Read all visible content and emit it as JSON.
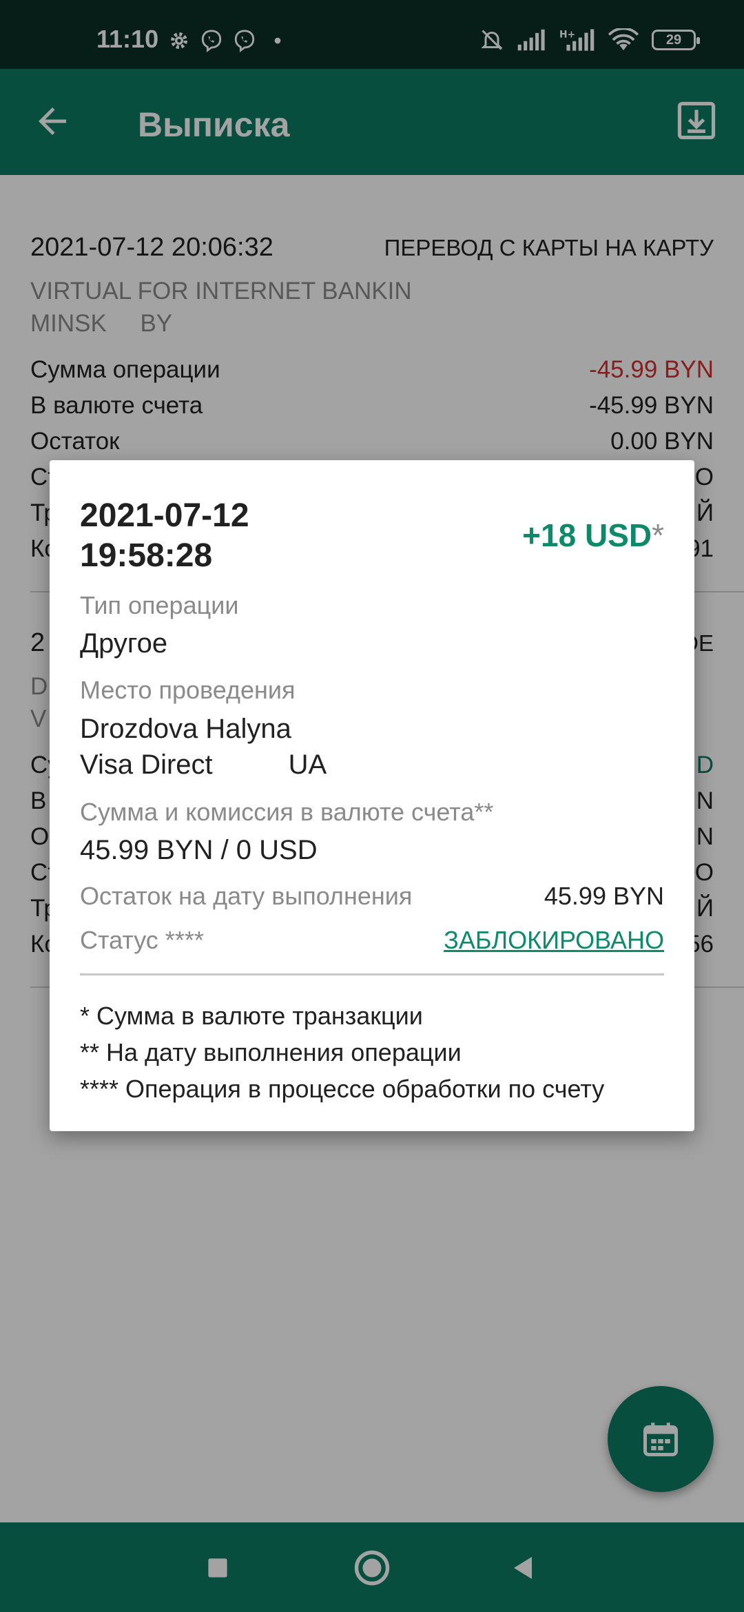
{
  "status_bar": {
    "time": "11:10",
    "icons_left": [
      "gear-icon",
      "viber-icon",
      "viber-icon",
      "dot-icon"
    ],
    "icons_right": [
      "mute-icon",
      "signal-icon",
      "signal-hplus-icon",
      "wifi-icon"
    ],
    "battery": "29"
  },
  "app_bar": {
    "title": "Выписка",
    "back_icon": "arrow-back-icon",
    "download_icon": "download-icon",
    "color": "#0d7a63"
  },
  "entries": [
    {
      "datetime": "2021-07-12 20:06:32",
      "type": "ПЕРЕВОД С КАРТЫ НА КАРТУ",
      "place_line1": "VIRTUAL FOR INTERNET BANKIN",
      "place_line2": "MINSK     BY",
      "rows": [
        {
          "label": "Сумма операции",
          "value": "-45.99 BYN"
        },
        {
          "label": "В валюте счета",
          "value": "-45.99 BYN"
        },
        {
          "label": "Остаток",
          "value": "0.00 BYN"
        },
        {
          "label": "Ст",
          "value": "О"
        },
        {
          "label": "Тр",
          "value": "Й"
        },
        {
          "label": "Ко",
          "value": "91"
        }
      ]
    },
    {
      "datetime": "2",
      "type": "DE",
      "place_line1": "D",
      "place_line2": "V",
      "rows": [
        {
          "label": "Су",
          "value": "D"
        },
        {
          "label": "В",
          "value": "N"
        },
        {
          "label": "О",
          "value": "N"
        },
        {
          "label": "Ст",
          "value": "О"
        },
        {
          "label": "Тр",
          "value": "Й"
        },
        {
          "label": "Ко",
          "value": "56"
        }
      ]
    }
  ],
  "dialog": {
    "date": "2021-07-12",
    "time": "19:58:28",
    "amount": "+18 USD",
    "amount_star": "*",
    "op_type_label": "Тип операции",
    "op_type_value": "Другое",
    "place_label": "Место проведения",
    "place_line1": "Drozdova Halyna",
    "place_line2": "Visa Direct",
    "place_country": "UA",
    "sum_label": "Сумма и комиссия в валюте счета**",
    "sum_value": "45.99 BYN / 0 USD",
    "balance_label": "Остаток на дату выполнения",
    "balance_value": "45.99 BYN",
    "status_label": "Статус ****",
    "status_value": "ЗАБЛОКИРОВАНО",
    "footnote1": "* Сумма в валюте транзакции",
    "footnote2": "** На дату выполнения операции",
    "footnote3": "**** Операция в процессе обработки по счету"
  },
  "fab": {
    "icon": "calendar-icon"
  },
  "nav_bar": {
    "icons": [
      "recents-square-icon",
      "home-circle-icon",
      "back-triangle-icon"
    ]
  }
}
